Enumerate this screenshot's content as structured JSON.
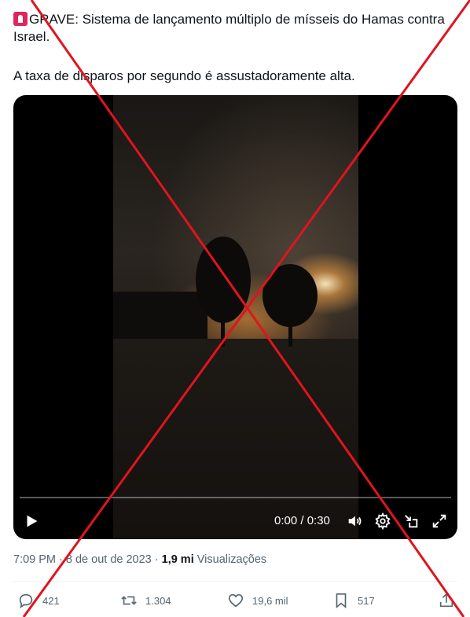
{
  "tweet": {
    "line1_text": "GRAVE: Sistema de lançamento múltiplo de mísseis do Hamas contra Israel.",
    "line2_text": "A taxa de disparos por segundo é assustadoramente alta."
  },
  "video": {
    "time_display": "0:00 / 0:30",
    "progress": 0
  },
  "meta": {
    "timestamp": "7:09 PM · 8 de out de 2023 ·",
    "views_count": "1,9 mi",
    "views_label": "Visualizações"
  },
  "actions": {
    "replies": "421",
    "reposts": "1.304",
    "likes": "19,6 mil",
    "bookmarks": "517"
  },
  "icons": [
    "siren-icon",
    "play-icon",
    "volume-icon",
    "gear-icon",
    "pip-icon",
    "fullscreen-icon",
    "reply-icon",
    "repost-icon",
    "like-icon",
    "bookmark-icon",
    "share-icon"
  ],
  "colors": {
    "overlay_x": "#e0141e",
    "text": "#0f1419",
    "muted": "#536471",
    "siren": "#e0245e"
  }
}
